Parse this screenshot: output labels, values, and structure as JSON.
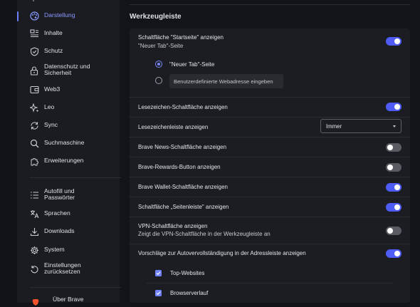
{
  "sidebar": {
    "items": [
      {
        "key": "darstellung",
        "label": "Darstellung",
        "icon": "palette-icon",
        "active": true
      },
      {
        "key": "inhalte",
        "label": "Inhalte",
        "icon": "content-list-icon"
      },
      {
        "key": "schutz",
        "label": "Schutz",
        "icon": "shield-check-icon"
      },
      {
        "key": "datenschutz",
        "label": "Datenschutz und\nSicherheit",
        "label1": "Datenschutz und",
        "label2": "Sicherheit",
        "icon": "lock-icon"
      },
      {
        "key": "web3",
        "label": "Web3",
        "icon": "wallet-icon"
      },
      {
        "key": "leo",
        "label": "Leo",
        "icon": "sparkle-icon"
      },
      {
        "key": "sync",
        "label": "Sync",
        "icon": "sync-icon"
      },
      {
        "key": "suchmaschine",
        "label": "Suchmaschine",
        "icon": "search-icon"
      },
      {
        "key": "erweiterungen",
        "label": "Erweiterungen",
        "icon": "puzzle-icon"
      },
      {
        "key": "autofill",
        "label1": "Autofill und",
        "label2": "Passwörter",
        "icon": "list-icon"
      },
      {
        "key": "sprachen",
        "label": "Sprachen",
        "icon": "translate-icon"
      },
      {
        "key": "downloads",
        "label": "Downloads",
        "icon": "download-icon"
      },
      {
        "key": "system",
        "label": "System",
        "icon": "gear-icon"
      },
      {
        "key": "reset",
        "label1": "Einstellungen",
        "label2": "zurücksetzen",
        "icon": "reset-icon"
      }
    ],
    "about_label": "Über Brave"
  },
  "main": {
    "section_title": "Werkzeugleiste",
    "rows": {
      "home_button": {
        "label": "Schaltfläche \"Startseite\" anzeigen",
        "sub": "\"Neuer Tab\"-Seite",
        "on": true
      },
      "radio_newtab": {
        "label": "\"Neuer Tab\"-Seite",
        "selected": true
      },
      "radio_custom": {
        "placeholder": "Benutzerdefinierte Webadresse eingeben",
        "selected": false
      },
      "bookmark_button": {
        "label": "Lesezeichen-Schaltfläche anzeigen",
        "on": true
      },
      "bookmark_bar": {
        "label": "Lesezeichenleiste anzeigen",
        "value": "Immer"
      },
      "brave_news": {
        "label": "Brave News-Schaltfläche anzeigen",
        "on": false
      },
      "brave_rewards": {
        "label": "Brave-Rewards-Button anzeigen",
        "on": false
      },
      "brave_wallet": {
        "label": "Brave Wallet-Schaltfläche anzeigen",
        "on": true
      },
      "sidebar_button": {
        "label": "Schaltfläche „Seitenleiste\" anzeigen",
        "on": true
      },
      "vpn": {
        "label": "VPN-Schaltfläche anzeigen",
        "sub": "Zeigt die VPN-Schaltfläche in der Werkzeugleiste an",
        "on": false
      },
      "autocomplete": {
        "label": "Vorschläge zur Autovervollständigung in der Adressleiste anzeigen",
        "on": true
      },
      "top_sites": {
        "label": "Top-Websites",
        "checked": true
      },
      "history": {
        "label": "Browserverlauf",
        "checked": true
      }
    }
  },
  "colors": {
    "accent": "#4e5cf5",
    "active_nav": "#8a9bff",
    "background": "#131419",
    "card": "#1c1d23"
  }
}
